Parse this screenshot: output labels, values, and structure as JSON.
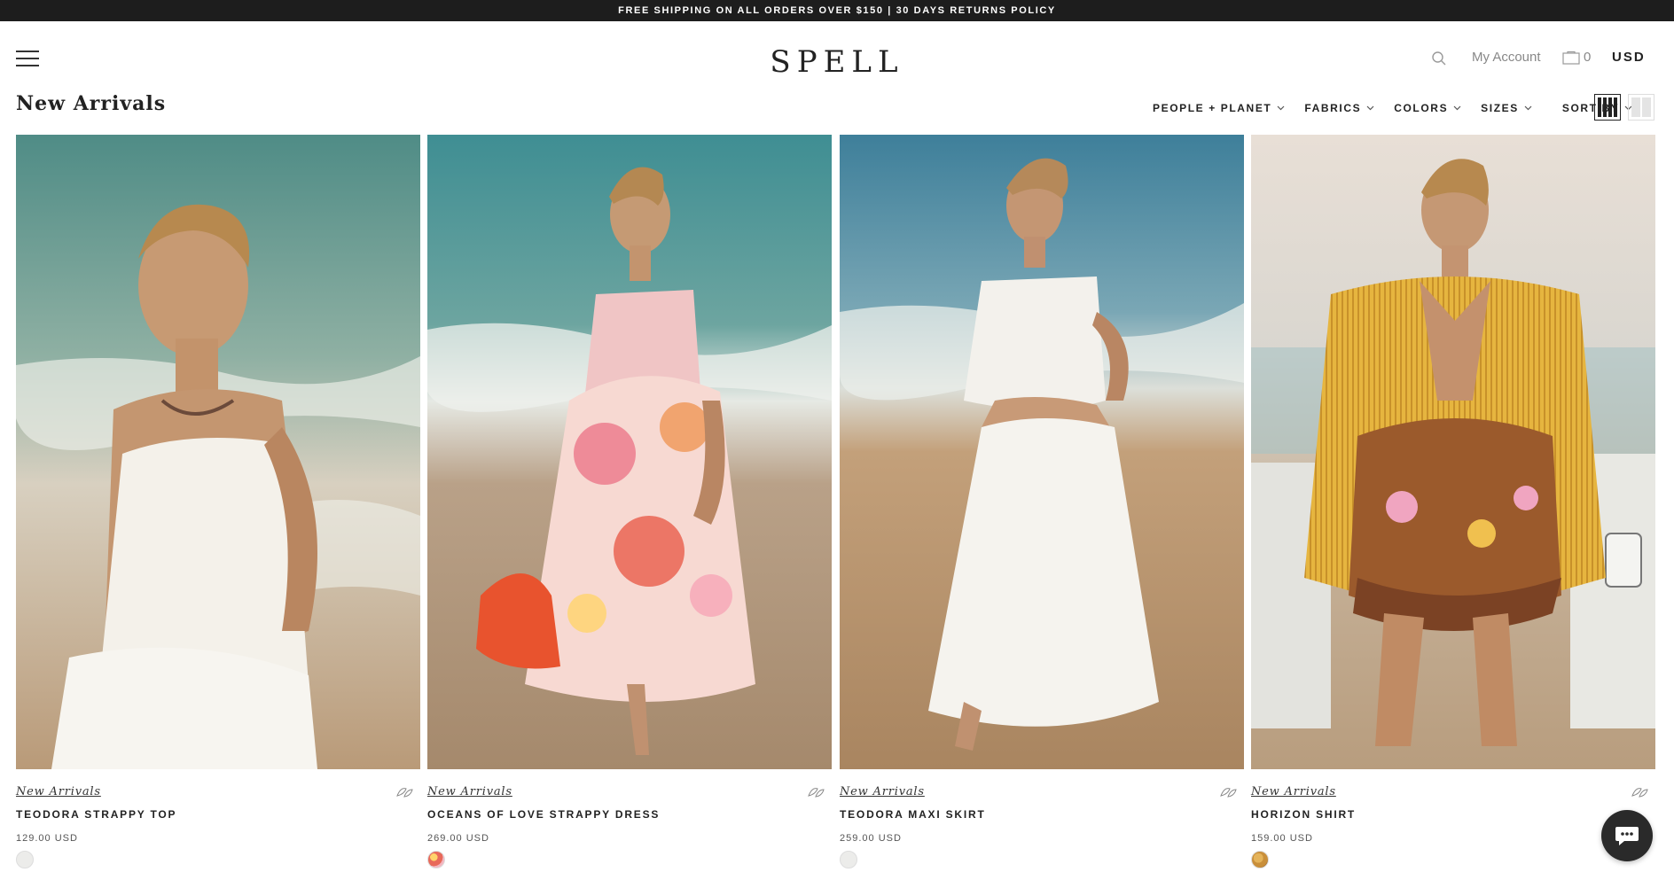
{
  "announcement": "FREE SHIPPING ON ALL ORDERS OVER $150 | 30 DAYS RETURNS POLICY",
  "header": {
    "logo": "SPELL",
    "account_label": "My Account",
    "cart_count": "0",
    "currency": "USD"
  },
  "page_title": "New Arrivals",
  "filters": [
    {
      "label": "PEOPLE + PLANET"
    },
    {
      "label": "FABRICS"
    },
    {
      "label": "COLORS"
    },
    {
      "label": "SIZES"
    },
    {
      "label": "SORT BY"
    }
  ],
  "icons": {
    "menu": "hamburger-menu-icon",
    "search": "search-icon",
    "cart": "shopping-bag-icon",
    "grid4": "grid-4-column-icon",
    "grid2": "grid-2-column-icon",
    "wishlist": "leaf-icon",
    "chat": "chat-bubble-icon"
  },
  "products": [
    {
      "collection": "New Arrivals",
      "name": "TEODORA STRAPPY TOP",
      "price": "129.00 USD",
      "swatch_color": "#ececea"
    },
    {
      "collection": "New Arrivals",
      "name": "OCEANS OF LOVE STRAPPY DRESS",
      "price": "269.00 USD",
      "swatch_color": "#e8695a"
    },
    {
      "collection": "New Arrivals",
      "name": "TEODORA MAXI SKIRT",
      "price": "259.00 USD",
      "swatch_color": "#ececea"
    },
    {
      "collection": "New Arrivals",
      "name": "HORIZON SHIRT",
      "price": "159.00 USD",
      "swatch_color": "#c98f3a"
    }
  ]
}
